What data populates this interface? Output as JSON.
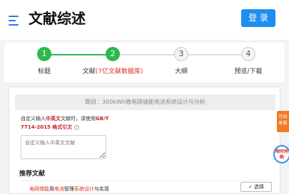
{
  "header": {
    "title": "文献综述",
    "login_label": "登 录"
  },
  "steps": [
    {
      "num": "1",
      "label": "标题",
      "label_extra": "",
      "status": "done"
    },
    {
      "num": "2",
      "label": "文献",
      "label_extra": "(7亿文献数据库)",
      "status": "done"
    },
    {
      "num": "3",
      "label": "大纲",
      "label_extra": "",
      "status": "todo"
    },
    {
      "num": "4",
      "label": "预览/下载",
      "label_extra": "",
      "status": "todo"
    }
  ],
  "main": {
    "topic": "题目：300kWh微电网储能电池系统设计与分析",
    "instruction_prefix": "自定义输入",
    "instruction_lang": "中英文",
    "instruction_mid": "文献时，请使用",
    "instruction_std": "GB/T 7714-2015 格式引文",
    "tip_icon": "i",
    "textarea_placeholder": "自定义输入中英文文献",
    "recommended_title": "推荐文献",
    "rec_item": {
      "part1": "电网储能",
      "part2": "用",
      "part3": "电池",
      "part4": "管理",
      "part5": "系统设计",
      "part6": "与",
      "part7": "实现"
    },
    "select_label": "✓ 选择"
  },
  "side": {
    "tab_text": "在线客服",
    "badge_text": "限时抢购"
  },
  "colors": {
    "accent": "#1e8ef0",
    "done": "#2db84d",
    "highlight": "#e0301e",
    "side_tab": "#f07a22"
  }
}
